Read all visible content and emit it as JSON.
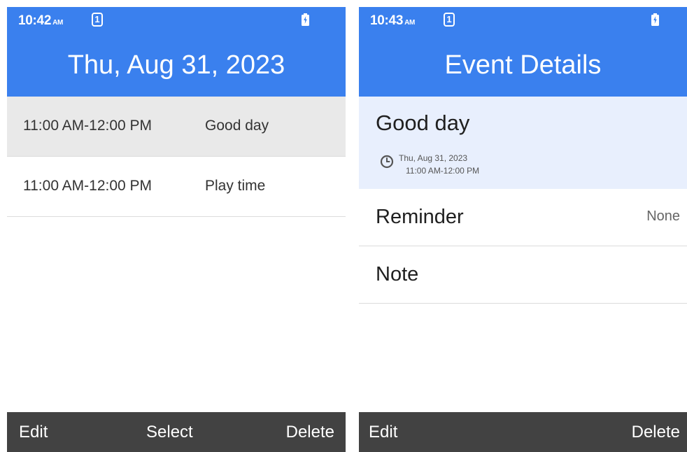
{
  "screens": [
    {
      "status": {
        "time": "10:42",
        "ampm": "AM",
        "sim": "1"
      },
      "header": {
        "title": "Thu, Aug 31, 2023"
      },
      "events": [
        {
          "time": "11:00 AM-12:00 PM",
          "title": "Good day",
          "selected": true
        },
        {
          "time": "11:00 AM-12:00 PM",
          "title": "Play time",
          "selected": false
        }
      ],
      "softkeys": {
        "left": "Edit",
        "center": "Select",
        "right": "Delete"
      }
    },
    {
      "status": {
        "time": "10:43",
        "ampm": "AM",
        "sim": "1"
      },
      "header": {
        "title": "Event Details"
      },
      "event": {
        "title": "Good day",
        "date": "Thu, Aug 31, 2023",
        "time": "11:00 AM-12:00 PM"
      },
      "rows": [
        {
          "label": "Reminder",
          "value": "None"
        },
        {
          "label": "Note",
          "value": ""
        }
      ],
      "softkeys": {
        "left": "Edit",
        "right": "Delete"
      }
    }
  ],
  "colors": {
    "header": "#3a80ee",
    "selected_row": "#e9e9e9",
    "detail_card": "#e8effd",
    "softkey_bar": "#424242"
  },
  "icons": {
    "sim": "sim-1-icon",
    "battery": "battery-charging-icon",
    "clock": "clock-icon"
  }
}
